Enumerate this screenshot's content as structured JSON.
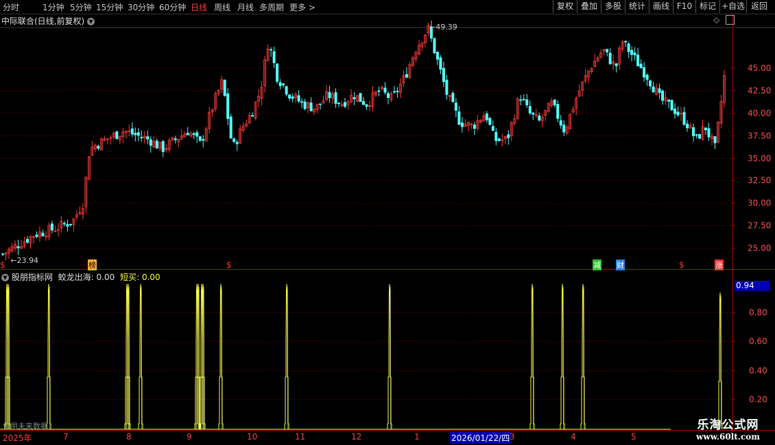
{
  "toolbar": {
    "periods": [
      "分时",
      "1分钟",
      "5分钟",
      "15分钟",
      "30分钟",
      "60分钟",
      "日线",
      "周线",
      "月线",
      "多周期",
      "更多"
    ],
    "active_period": "日线",
    "buttons": [
      "复权",
      "叠加",
      "多股",
      "统计",
      "画线",
      "F10",
      "标记",
      "+自选",
      "返回"
    ]
  },
  "stock_header": {
    "title": "中际联合(日线,前复权)"
  },
  "price_axis": {
    "labels": [
      "45.00",
      "42.50",
      "40.00",
      "37.50",
      "35.00",
      "32.50",
      "30.00",
      "27.50",
      "25.00"
    ]
  },
  "annotations": {
    "high_label": "49.39",
    "low_label": "23.94"
  },
  "event_markers": [
    {
      "text": "$",
      "color": "#ff3030"
    },
    {
      "text": "榜",
      "color": "#ffb040"
    },
    {
      "text": "$",
      "color": "#ff3030"
    },
    {
      "text": "减",
      "color": "#30c030"
    },
    {
      "text": "财",
      "color": "#4090ff"
    },
    {
      "text": "$",
      "color": "#ff3030"
    },
    {
      "text": "涨",
      "color": "#ff3030"
    }
  ],
  "indicator_header": {
    "name": "股朋指标网",
    "line1_label": "蛟龙出海:",
    "line1_value": "0.00",
    "line2_label": "短买:",
    "line2_value": "0.00"
  },
  "indicator_axis": {
    "labels": [
      "0.80",
      "0.60",
      "0.40",
      "0.20"
    ],
    "current_value": "0.94"
  },
  "indicator_footer": "使用未来数据",
  "date_axis": {
    "labels": [
      "2025年",
      "7",
      "8",
      "9",
      "10",
      "11",
      "12",
      "1",
      "3",
      "4",
      "5"
    ],
    "cursor_date": "2026/01/22/四"
  },
  "watermark": {
    "title": "乐淘公式网",
    "url": "www.60lt.com"
  },
  "colors": {
    "up": "#ff3c3c",
    "down": "#54ffff",
    "signal": "#ffff40",
    "grid": "#8b0000",
    "cursor_bg": "#0000b0"
  },
  "chart_data": {
    "type": "candlestick",
    "y_range": [
      23.5,
      51
    ],
    "sessions": 235,
    "anchors": [
      [
        0,
        24.3
      ],
      [
        10,
        25.2
      ],
      [
        25,
        26.5
      ],
      [
        40,
        27.1
      ],
      [
        55,
        28.0
      ],
      [
        63,
        30.0
      ],
      [
        68,
        36.0
      ],
      [
        80,
        37.0
      ],
      [
        95,
        38.0
      ],
      [
        115,
        37.0
      ],
      [
        125,
        36.0
      ],
      [
        135,
        37.0
      ],
      [
        145,
        38.0
      ],
      [
        155,
        36.5
      ],
      [
        165,
        41.0
      ],
      [
        172,
        43.5
      ],
      [
        180,
        36.0
      ],
      [
        188,
        38.5
      ],
      [
        195,
        40.0
      ],
      [
        202,
        42.5
      ],
      [
        208,
        48.0
      ],
      [
        215,
        44.0
      ],
      [
        225,
        42.0
      ],
      [
        235,
        41.0
      ],
      [
        245,
        40.5
      ],
      [
        255,
        42.0
      ],
      [
        265,
        41.0
      ],
      [
        275,
        42.0
      ],
      [
        285,
        41.0
      ],
      [
        295,
        42.5
      ],
      [
        305,
        41.5
      ],
      [
        315,
        44.0
      ],
      [
        323,
        47.0
      ],
      [
        333,
        49.39
      ],
      [
        340,
        46.0
      ],
      [
        348,
        42.0
      ],
      [
        358,
        39.0
      ],
      [
        368,
        38.5
      ],
      [
        378,
        40.0
      ],
      [
        385,
        37.0
      ],
      [
        395,
        37.0
      ],
      [
        405,
        42.0
      ],
      [
        412,
        40.0
      ],
      [
        420,
        39.0
      ],
      [
        430,
        41.0
      ],
      [
        440,
        38.0
      ],
      [
        450,
        42.0
      ],
      [
        460,
        45.0
      ],
      [
        470,
        47.0
      ],
      [
        480,
        45.0
      ],
      [
        485,
        48.0
      ],
      [
        495,
        46.0
      ],
      [
        505,
        44.0
      ],
      [
        515,
        41.5
      ],
      [
        525,
        40.5
      ],
      [
        535,
        39.0
      ],
      [
        543,
        37.0
      ],
      [
        550,
        38.5
      ],
      [
        558,
        36.0
      ],
      [
        565,
        44.0
      ]
    ],
    "x_range": [
      0,
      565
    ],
    "high": {
      "index": 333,
      "value": 49.39
    },
    "low": {
      "index": 5,
      "value": 23.94
    }
  },
  "signal_data": {
    "type": "spike",
    "positions": [
      10,
      12,
      71,
      185,
      187,
      205,
      287,
      289,
      294,
      296,
      322,
      418,
      568,
      776,
      820,
      850,
      1050
    ],
    "heights": [
      1,
      1,
      1,
      1,
      1,
      1,
      1,
      1,
      1,
      1,
      1,
      1,
      1,
      1,
      1,
      1,
      0.94
    ]
  }
}
